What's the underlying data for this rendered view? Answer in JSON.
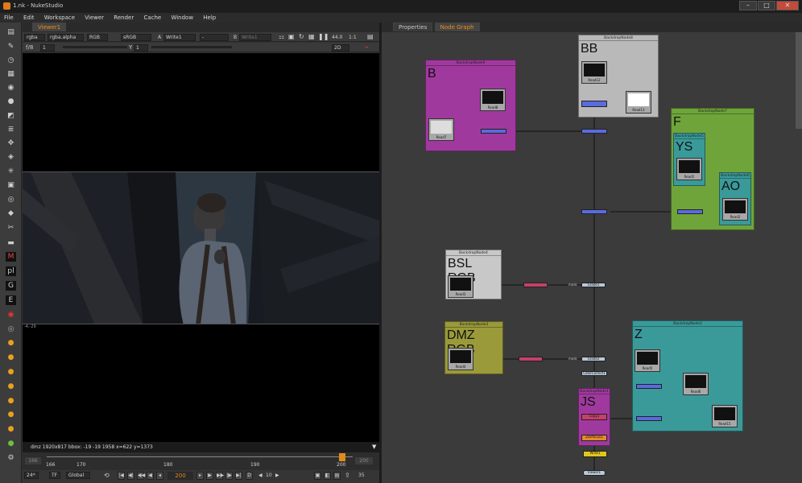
{
  "window": {
    "title": "1.nk - NukeStudio"
  },
  "menu": [
    "File",
    "Edit",
    "Workspace",
    "Viewer",
    "Render",
    "Cache",
    "Window",
    "Help"
  ],
  "viewer": {
    "tab": "Viewer1",
    "channels": "rgba",
    "alpha": "rgba.alpha",
    "display": "RGB",
    "colorspace": "sRGB",
    "input_a_label": "A",
    "input_a": "Write1",
    "input_mid": "-",
    "input_b_label": "B",
    "input_b": "Write1",
    "zoom": "44.0",
    "ratio": "1:1",
    "fstop": "f/8",
    "gain": "1",
    "y_label": "Y",
    "y_val": "1",
    "mode": "2D",
    "corner_label": "-4,-29",
    "status": "dmz 1920x817  bbox: -19 -19 1958   x=622 y=1373"
  },
  "timeline": {
    "start": "166",
    "ticks": [
      "166",
      "170",
      "180",
      "190",
      "200"
    ],
    "end": "200",
    "current": "200",
    "fps": "24*",
    "tf": "TF",
    "scope": "Global",
    "step": "10",
    "frame_count": "35"
  },
  "nodegraph": {
    "tabs": [
      "Properties",
      "Node Graph"
    ],
    "backdrops": [
      {
        "id": "bd9",
        "header": "BackdropNode9",
        "title": "B"
      },
      {
        "id": "bd8",
        "header": "BackdropNode8",
        "title": "BB"
      },
      {
        "id": "bd7",
        "header": "BackdropNode7",
        "title": "F"
      },
      {
        "id": "bd5",
        "header": "BackdropNode5",
        "title": "YS"
      },
      {
        "id": "bd6",
        "header": "BackdropNode6",
        "title": "AO"
      },
      {
        "id": "bd4",
        "header": "BackdropNode4",
        "title": "BSL RGB"
      },
      {
        "id": "bd3",
        "header": "BackdropNode3",
        "title": "DMZ RGB"
      },
      {
        "id": "bd2",
        "header": "BackdropNode2",
        "title": "Z"
      },
      {
        "id": "bd1",
        "header": "BackdropNode1",
        "title": "JS"
      }
    ],
    "reads": {
      "read8": {
        "name": "Read8",
        "file": "sc_1_2_mam_183.exr"
      },
      "read7": {
        "name": "Read7",
        "file": "sc_1_2_mam_183.exr"
      },
      "read12": {
        "name": "Read12",
        "file": "sc_1_2_d_183.exr"
      },
      "read13": {
        "name": "Read13",
        "file": "sc_1_2_d_183.exr"
      },
      "read1": {
        "name": "Read1",
        "file": "sc_1_2_d_200.exr"
      },
      "read2": {
        "name": "Read2",
        "file": "sc_1_2_d_200.exr"
      },
      "read3": {
        "name": "Read3",
        "file": "sc_1_2_d_200.exr"
      },
      "read4": {
        "name": "Read4",
        "file": "sc_1_2_d_200.exr"
      },
      "read5": {
        "name": "Read5",
        "file": "sc_1_2_d_200.exr"
      },
      "read6": {
        "name": "Read6",
        "file": "sc_1_2_mam_183.exr"
      },
      "read15": {
        "name": "Read15",
        "file": "sc_1_2_d01.exr"
      }
    },
    "nodes": {
      "grade1": "Grade1",
      "grade2": "Grade2",
      "colorcorrect": "ColorCorrect1",
      "copy1": "Copy1",
      "zdefocus": "ZDefocus1",
      "write1": "Write1",
      "viewer1": "Viewer1",
      "mask": "mask"
    }
  }
}
